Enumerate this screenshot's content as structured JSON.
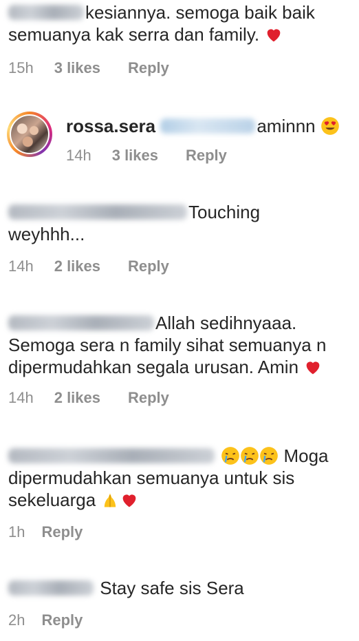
{
  "comments": [
    {
      "text": "kesiannya. semoga baik baik semuanya kak serra dan family.",
      "time": "15h",
      "likes": "3 likes",
      "reply": "Reply"
    },
    {
      "username": "rossa.sera",
      "text": "aminnn",
      "time": "14h",
      "likes": "3 likes",
      "reply": "Reply"
    },
    {
      "text_line1": "Touching",
      "text_line2": "weyhhh...",
      "time": "14h",
      "likes": "2 likes",
      "reply": "Reply"
    },
    {
      "text_line1": "Allah sedihnyaaa.",
      "text_line2": "Semoga sera n family sihat semuanya n",
      "text_line3": "dipermudahkan segala urusan. Amin",
      "time": "14h",
      "likes": "2 likes",
      "reply": "Reply"
    },
    {
      "text_line1": "Moga",
      "text_line2": "dipermudahkan semuanya  untuk sis",
      "text_line3": "sekeluarga",
      "time": "1h",
      "reply": "Reply"
    },
    {
      "text": "Stay safe sis Sera",
      "time": "2h",
      "reply": "Reply"
    }
  ],
  "icons": {
    "heart": "red-heart-icon",
    "heart_eyes": "heart-eyes-emoji-icon",
    "crying": "crying-face-emoji-icon",
    "praying": "folded-hands-emoji-icon"
  },
  "colors": {
    "text": "#262626",
    "meta": "#8e8e8e",
    "heart": "#e0202d"
  }
}
